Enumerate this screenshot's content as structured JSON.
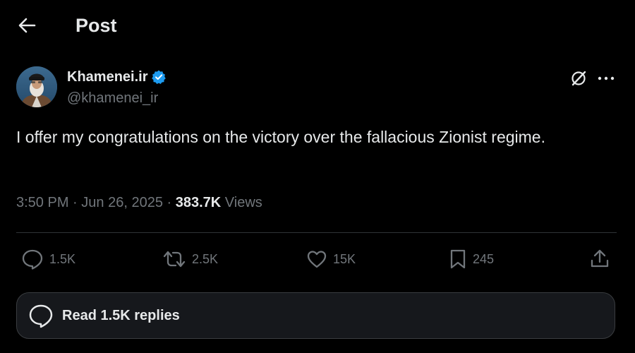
{
  "header": {
    "back_icon": "arrow-left-icon",
    "title": "Post"
  },
  "author": {
    "name": "Khamenei.ir",
    "handle": "@khamenei_ir",
    "verified_icon": "verified-badge-icon",
    "verified_color": "#1d9bf0",
    "avatar_icon": "avatar"
  },
  "tweet": {
    "text": "I offer my congratulations on the victory over the fallacious Zionist regime."
  },
  "meta": {
    "time": "3:50 PM",
    "separator": "·",
    "date": "Jun 26, 2025",
    "views_count": "383.7K",
    "views_label": "Views"
  },
  "actions": {
    "replies": "1.5K",
    "reposts": "2.5K",
    "likes": "15K",
    "bookmarks": "245"
  },
  "read_replies": {
    "label": "Read 1.5K replies"
  },
  "colors": {
    "background": "#000000",
    "text": "#e7e9ea",
    "muted": "#71767b",
    "divider": "#2f3336",
    "accent": "#1d9bf0"
  }
}
